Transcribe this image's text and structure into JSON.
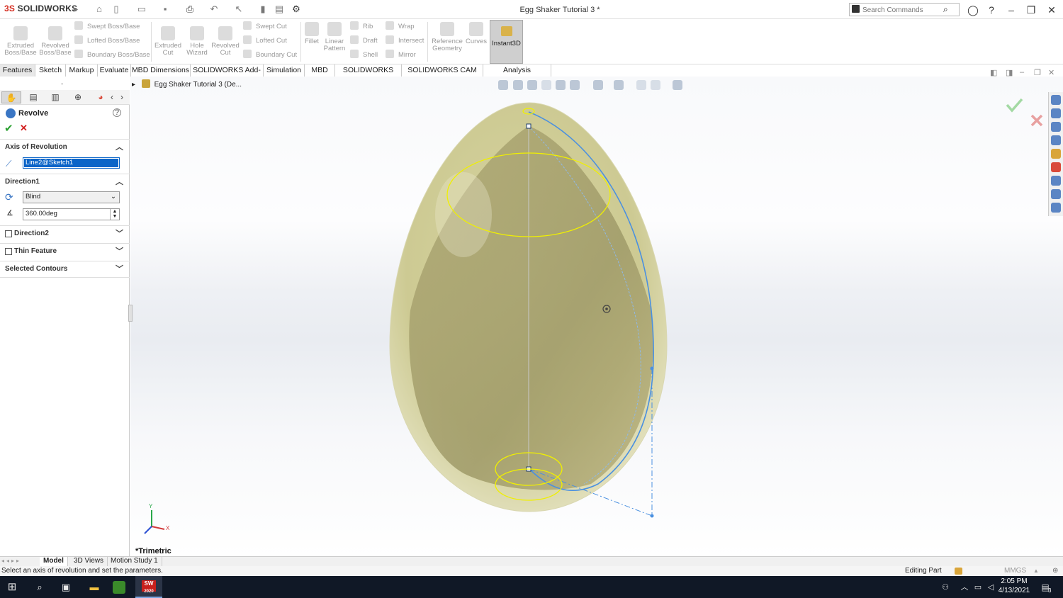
{
  "app": {
    "brand_ds": "3S",
    "brand_name": "SOLIDWORKS",
    "title": "Egg Shaker Tutorial 3 *",
    "search_placeholder": "Search Commands"
  },
  "ribbon": {
    "extruded_boss": "Extruded Boss/Base",
    "revolved_boss": "Revolved Boss/Base",
    "swept_boss": "Swept Boss/Base",
    "lofted_boss": "Lofted Boss/Base",
    "boundary_boss": "Boundary Boss/Base",
    "extruded_cut": "Extruded Cut",
    "hole_wizard": "Hole Wizard",
    "revolved_cut": "Revolved Cut",
    "swept_cut": "Swept Cut",
    "lofted_cut": "Lofted Cut",
    "boundary_cut": "Boundary Cut",
    "fillet": "Fillet",
    "linear_pattern": "Linear Pattern",
    "rib": "Rib",
    "draft": "Draft",
    "shell": "Shell",
    "wrap": "Wrap",
    "intersect": "Intersect",
    "mirror": "Mirror",
    "reference_geometry": "Reference Geometry",
    "curves": "Curves",
    "instant3d": "Instant3D"
  },
  "tabs": [
    "Features",
    "Sketch",
    "Markup",
    "Evaluate",
    "MBD Dimensions",
    "SOLIDWORKS Add-Ins",
    "Simulation",
    "MBD",
    "SOLIDWORKS CAM",
    "SOLIDWORKS CAM TBM",
    "Analysis Preparation"
  ],
  "feature_tree": {
    "root": "Egg Shaker Tutorial 3  (De..."
  },
  "property_manager": {
    "title": "Revolve",
    "axis_section": "Axis of Revolution",
    "axis_value": "Line2@Sketch1",
    "direction1_section": "Direction1",
    "end_condition": "Blind",
    "angle": "360.00deg",
    "direction2_section": "Direction2",
    "thin_feature_section": "Thin Feature",
    "selected_contours_section": "Selected Contours"
  },
  "viewport": {
    "view_label": "*Trimetric",
    "triad_x": "X",
    "triad_y": "Y"
  },
  "bottom_tabs": [
    "Model",
    "3D Views",
    "Motion Study 1"
  ],
  "status": {
    "message": "Select an axis of revolution and set the parameters.",
    "mode": "Editing Part",
    "units": "MMGS"
  },
  "taskbar": {
    "time": "2:05 PM",
    "date": "4/13/2021",
    "sw_year": "2020",
    "notif_count": "3"
  },
  "colors": {
    "accent_blue": "#0a64c8",
    "sketch_blue": "#4a90e0",
    "highlight_yellow": "#f0f000",
    "egg_fill": "#c9c58a",
    "taskbar": "#101826"
  }
}
